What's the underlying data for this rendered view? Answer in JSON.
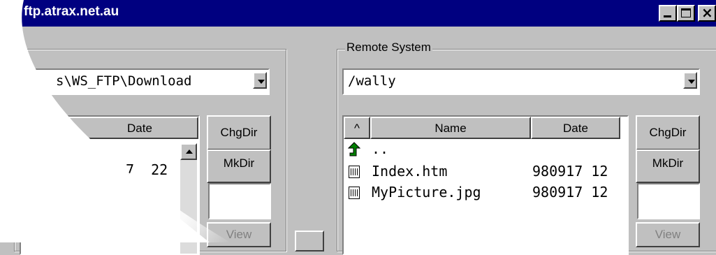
{
  "window": {
    "title": "ftp.atrax.net.au"
  },
  "local": {
    "path": "s\\WS_FTP\\Download",
    "headers": {
      "date": "Date"
    },
    "partial_rows": [
      "7  22",
      ""
    ],
    "buttons": {
      "chgdir": "ChgDir",
      "mkdir": "MkDir",
      "view": "View"
    }
  },
  "remote": {
    "group_label": "Remote System",
    "path": "/wally",
    "headers": {
      "sort": "^",
      "name": "Name",
      "date": "Date"
    },
    "rows": [
      {
        "name": "..",
        "date": ""
      },
      {
        "name": "Index.htm",
        "date": "980917 12"
      },
      {
        "name": "MyPicture.jpg",
        "date": "980917 12"
      }
    ],
    "buttons": {
      "chgdir": "ChgDir",
      "mkdir": "MkDir",
      "view": "View"
    }
  },
  "icons": [
    "up-folder-icon",
    "file-icon",
    "minimize-icon",
    "maximize-icon",
    "close-icon",
    "scroll-up-icon",
    "dropdown-arrow-icon"
  ]
}
